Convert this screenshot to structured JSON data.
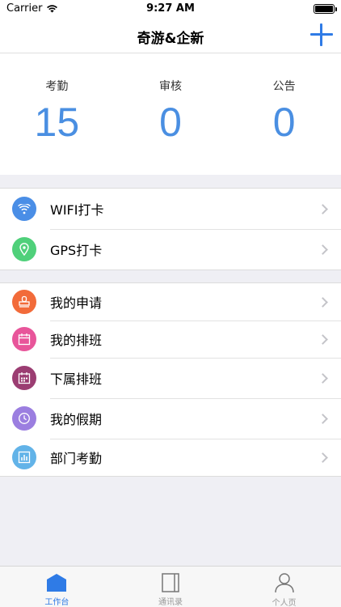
{
  "status_bar": {
    "carrier": "Carrier",
    "time": "9:27 AM"
  },
  "nav": {
    "title": "奇游&企新",
    "add_icon": "plus-icon"
  },
  "stats": [
    {
      "label": "考勤",
      "value": "15"
    },
    {
      "label": "审核",
      "value": "0"
    },
    {
      "label": "公告",
      "value": "0"
    }
  ],
  "group1": [
    {
      "label": "WIFI打卡",
      "icon": "wifi-icon",
      "color": "#4a8ee6"
    },
    {
      "label": "GPS打卡",
      "icon": "location-pin-icon",
      "color": "#4fd07a"
    }
  ],
  "group2": [
    {
      "label": "我的申请",
      "icon": "stamp-icon",
      "color": "#f26b3a"
    },
    {
      "label": "我的排班",
      "icon": "calendar-icon",
      "color": "#e8559a"
    },
    {
      "label": "下属排班",
      "icon": "calendar-grid-icon",
      "color": "#9b3d72"
    },
    {
      "label": "我的假期",
      "icon": "clock-icon",
      "color": "#9b7ee0"
    },
    {
      "label": "部门考勤",
      "icon": "bar-chart-icon",
      "color": "#62b3e8"
    }
  ],
  "tabs": [
    {
      "label": "工作台",
      "icon": "home-icon",
      "active": true
    },
    {
      "label": "通讯录",
      "icon": "book-icon",
      "active": false
    },
    {
      "label": "个人页",
      "icon": "person-icon",
      "active": false
    }
  ],
  "colors": {
    "accent": "#2f7be6",
    "stat_number": "#4a8fe2",
    "background": "#efeff4"
  }
}
